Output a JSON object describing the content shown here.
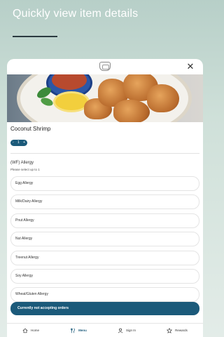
{
  "promo": {
    "title": "Quickly view item details"
  },
  "item": {
    "name": "Coconut Shrimp",
    "quantity": "1",
    "decrement": "-",
    "increment": "+"
  },
  "modifier_group": {
    "title": "(WF) Allergy",
    "subtitle": "Please select up to 1",
    "options": [
      "Egg Allergy",
      "Milk/Dairy Allergy",
      "Pnut Allergy",
      "Nut Allergy",
      "Treenut Allergy",
      "Soy Allergy",
      "Wheat/Gluten Allergy"
    ]
  },
  "banner": {
    "text": "Currently not accepting orders"
  },
  "nav": {
    "items": [
      {
        "label": "Home",
        "icon": "home-icon"
      },
      {
        "label": "Menu",
        "icon": "fork-knife-icon"
      },
      {
        "label": "Sign In",
        "icon": "person-icon"
      },
      {
        "label": "Rewards",
        "icon": "star-icon"
      }
    ],
    "active": "Menu"
  },
  "colors": {
    "accent": "#1b5a7a",
    "background_top": "#b7cfc8",
    "background_bottom": "#e3ece8"
  }
}
